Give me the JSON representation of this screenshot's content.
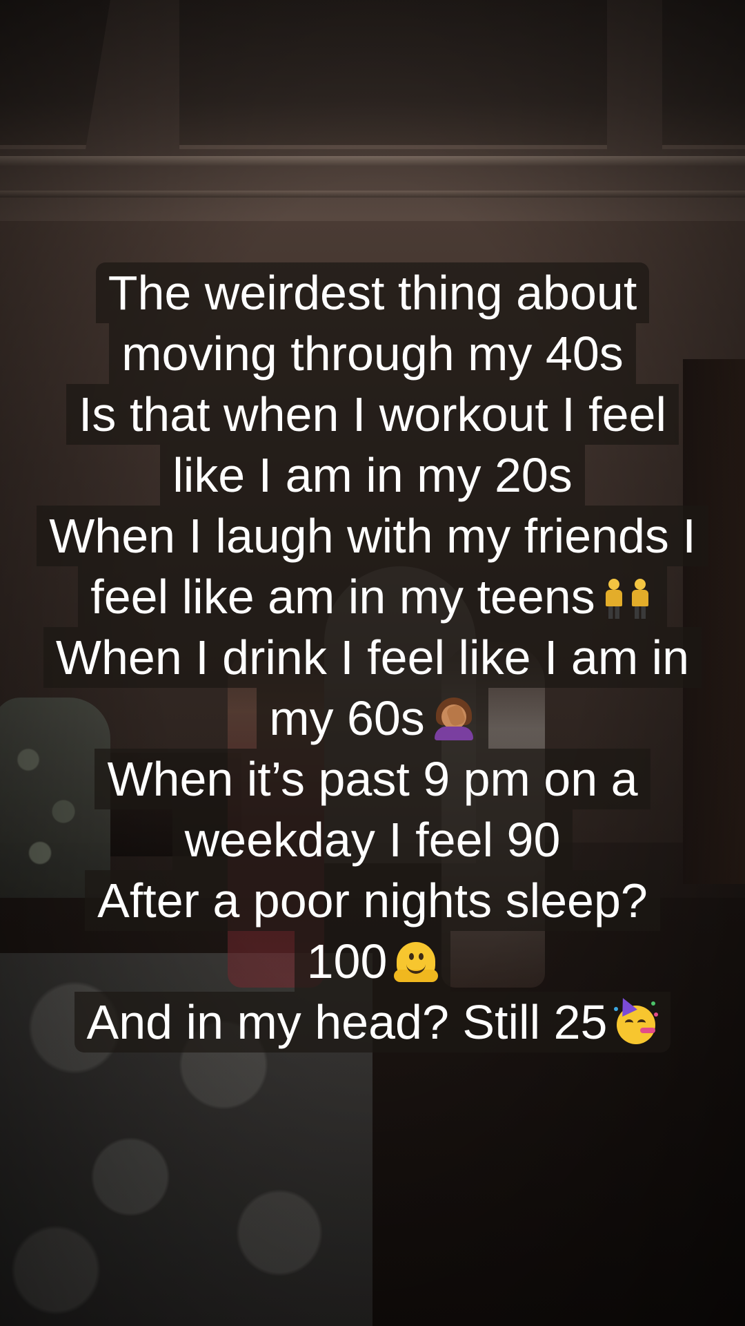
{
  "caption": {
    "lines": [
      {
        "text": "The weirdest thing about"
      },
      {
        "text": "moving through my 40s"
      },
      {
        "text": "Is that when I workout I feel"
      },
      {
        "text": "like I am in my 20s"
      },
      {
        "text": "When I laugh with my friends I"
      },
      {
        "text": "feel like am in my teens",
        "emoji": "women-with-bunny-ears-icon"
      },
      {
        "text": "When I drink I feel like I am in"
      },
      {
        "text": "my 60s",
        "emoji": "woman-facepalming-icon"
      },
      {
        "text": "When it’s past 9 pm on a"
      },
      {
        "text": "weekday I feel 90"
      },
      {
        "text": "After a poor nights sleep?"
      },
      {
        "text": "100",
        "emoji": "melting-face-icon"
      },
      {
        "text": "And in my head?  Still 25",
        "emoji": "partying-face-icon"
      }
    ]
  }
}
